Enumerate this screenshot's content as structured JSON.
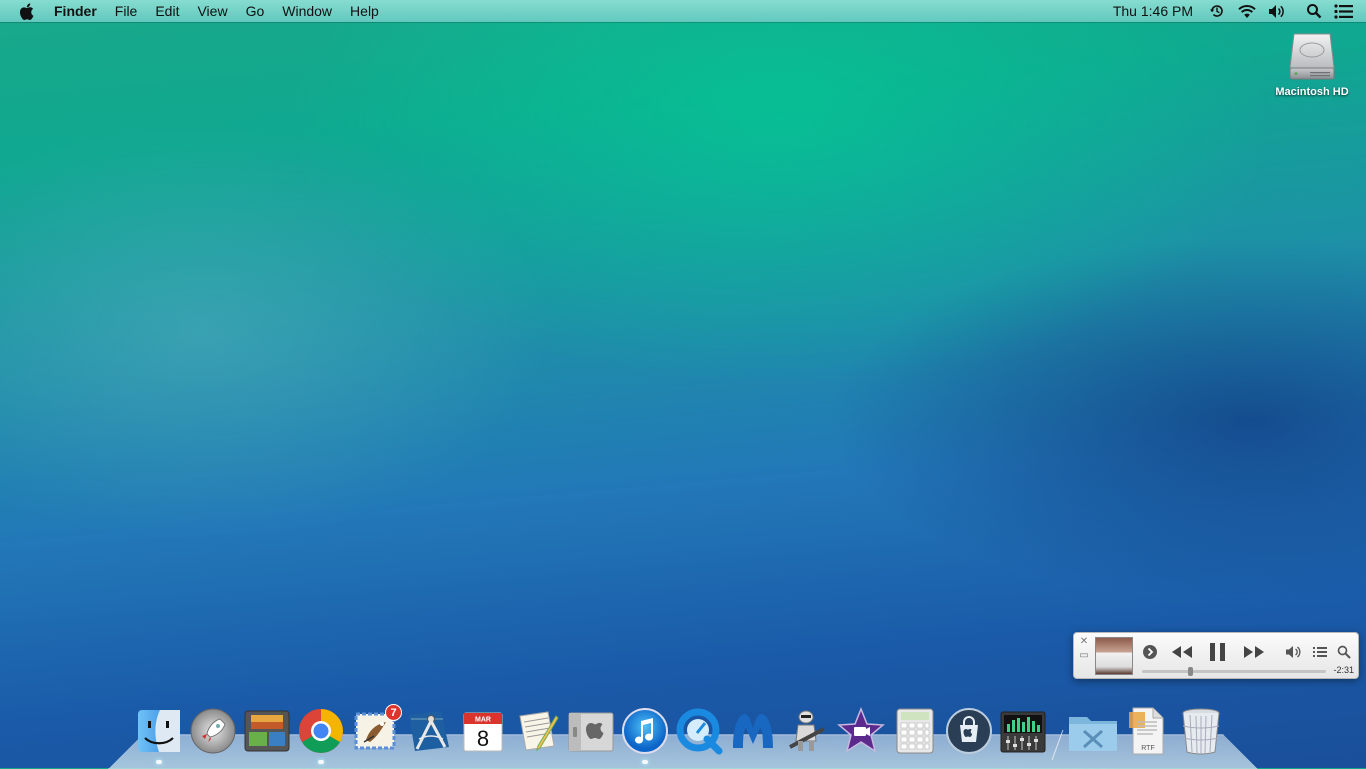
{
  "menubar": {
    "apple_icon": "apple-logo-icon",
    "app_name": "Finder",
    "menus": [
      "File",
      "Edit",
      "View",
      "Go",
      "Window",
      "Help"
    ],
    "clock": "Thu 1:46 PM",
    "status_icons": [
      "time-machine-icon",
      "wifi-icon",
      "volume-icon",
      "spotlight-icon",
      "notification-center-icon"
    ]
  },
  "desktop": {
    "icons": [
      {
        "label": "Macintosh HD",
        "icon": "hard-drive-icon"
      }
    ]
  },
  "miniplayer": {
    "time_remaining": "-2:31",
    "progress": 0.25,
    "icons": [
      "close-icon",
      "expand-icon",
      "album-art",
      "up-next-icon",
      "rewind-icon",
      "pause-icon",
      "fast-forward-icon",
      "volume-icon",
      "list-icon",
      "search-icon"
    ]
  },
  "dock": {
    "apps": [
      {
        "name": "Finder",
        "icon": "finder-icon"
      },
      {
        "name": "Launchpad",
        "icon": "launchpad-icon"
      },
      {
        "name": "Image Capture",
        "icon": "photos-icon"
      },
      {
        "name": "Google Chrome",
        "icon": "chrome-icon"
      },
      {
        "name": "Mail",
        "icon": "mail-icon",
        "badge": "7"
      },
      {
        "name": "Instruments",
        "icon": "compass-icon"
      },
      {
        "name": "Calendar",
        "icon": "calendar-icon",
        "month": "MAR",
        "day": "8"
      },
      {
        "name": "TextEdit",
        "icon": "textedit-icon"
      },
      {
        "name": "Boot Camp Assistant",
        "icon": "bootcamp-icon"
      },
      {
        "name": "iTunes",
        "icon": "itunes-icon"
      },
      {
        "name": "QuickTime Player",
        "icon": "quicktime-icon"
      },
      {
        "name": "Malwarebytes",
        "icon": "malwarebytes-icon"
      },
      {
        "name": "Automator",
        "icon": "automator-icon"
      },
      {
        "name": "iMovie",
        "icon": "imovie-icon"
      },
      {
        "name": "Calculator",
        "icon": "calculator-icon"
      },
      {
        "name": "App Store",
        "icon": "app-store-icon"
      },
      {
        "name": "Audio MIDI Setup",
        "icon": "audio-mixer-icon"
      }
    ],
    "others": [
      {
        "name": "Utilities",
        "icon": "utilities-folder-icon"
      },
      {
        "name": "RTF Document",
        "icon": "rtf-document-icon",
        "file_type": "RTF"
      },
      {
        "name": "Trash",
        "icon": "trash-icon"
      }
    ]
  }
}
